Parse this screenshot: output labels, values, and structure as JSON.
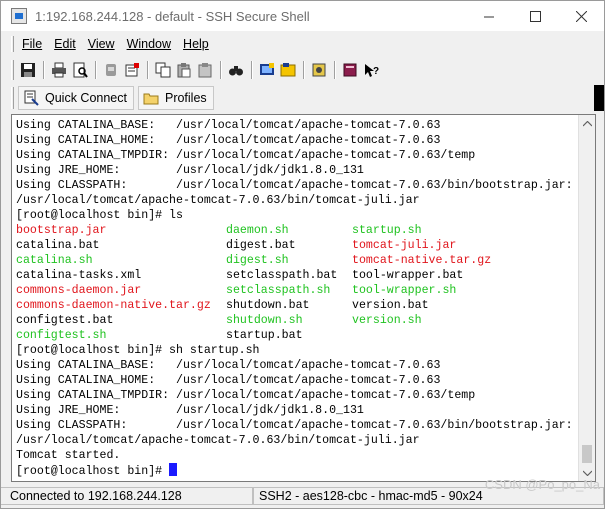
{
  "window": {
    "title": "1:192.168.244.128 - default - SSH Secure Shell",
    "controls": {
      "minimize": "minimize",
      "maximize": "maximize",
      "close": "close"
    }
  },
  "menu": {
    "items": [
      {
        "label": "File"
      },
      {
        "label": "Edit"
      },
      {
        "label": "View"
      },
      {
        "label": "Window"
      },
      {
        "label": "Help"
      }
    ]
  },
  "toolbar": {
    "icons": [
      "save-icon",
      "print-icon",
      "print-preview-icon",
      "disconnect-icon",
      "edit-profile-icon",
      "copy-icon",
      "paste-icon",
      "paste-selection-icon",
      "find-icon",
      "new-terminal-icon",
      "file-transfer-icon",
      "settings-icon",
      "help-book-icon",
      "whats-this-icon"
    ]
  },
  "quickbar": {
    "quick_connect": "Quick Connect",
    "profiles": "Profiles"
  },
  "terminal": {
    "lines_top": [
      "Using CATALINA_BASE:   /usr/local/tomcat/apache-tomcat-7.0.63",
      "Using CATALINA_HOME:   /usr/local/tomcat/apache-tomcat-7.0.63",
      "Using CATALINA_TMPDIR: /usr/local/tomcat/apache-tomcat-7.0.63/temp",
      "Using JRE_HOME:        /usr/local/jdk/jdk1.8.0_131",
      "Using CLASSPATH:       /usr/local/tomcat/apache-tomcat-7.0.63/bin/bootstrap.jar:",
      "/usr/local/tomcat/apache-tomcat-7.0.63/bin/tomcat-juli.jar",
      "[root@localhost bin]# ls"
    ],
    "ls_rows": [
      [
        {
          "t": "bootstrap.jar",
          "c": "red"
        },
        {
          "t": "daemon.sh",
          "c": "green"
        },
        {
          "t": "startup.sh",
          "c": "green"
        }
      ],
      [
        {
          "t": "catalina.bat",
          "c": ""
        },
        {
          "t": "digest.bat",
          "c": ""
        },
        {
          "t": "tomcat-juli.jar",
          "c": "red"
        }
      ],
      [
        {
          "t": "catalina.sh",
          "c": "green"
        },
        {
          "t": "digest.sh",
          "c": "green"
        },
        {
          "t": "tomcat-native.tar.gz",
          "c": "red"
        }
      ],
      [
        {
          "t": "catalina-tasks.xml",
          "c": ""
        },
        {
          "t": "setclasspath.bat",
          "c": ""
        },
        {
          "t": "tool-wrapper.bat",
          "c": ""
        }
      ],
      [
        {
          "t": "commons-daemon.jar",
          "c": "red"
        },
        {
          "t": "setclasspath.sh",
          "c": "green"
        },
        {
          "t": "tool-wrapper.sh",
          "c": "green"
        }
      ],
      [
        {
          "t": "commons-daemon-native.tar.gz",
          "c": "red"
        },
        {
          "t": "shutdown.bat",
          "c": ""
        },
        {
          "t": "version.bat",
          "c": ""
        }
      ],
      [
        {
          "t": "configtest.bat",
          "c": ""
        },
        {
          "t": "shutdown.sh",
          "c": "green"
        },
        {
          "t": "version.sh",
          "c": "green"
        }
      ],
      [
        {
          "t": "configtest.sh",
          "c": "green"
        },
        {
          "t": "startup.bat",
          "c": ""
        },
        {
          "t": "",
          "c": ""
        }
      ]
    ],
    "lines_bottom": [
      "[root@localhost bin]# sh startup.sh",
      "Using CATALINA_BASE:   /usr/local/tomcat/apache-tomcat-7.0.63",
      "Using CATALINA_HOME:   /usr/local/tomcat/apache-tomcat-7.0.63",
      "Using CATALINA_TMPDIR: /usr/local/tomcat/apache-tomcat-7.0.63/temp",
      "Using JRE_HOME:        /usr/local/jdk/jdk1.8.0_131",
      "Using CLASSPATH:       /usr/local/tomcat/apache-tomcat-7.0.63/bin/bootstrap.jar:",
      "/usr/local/tomcat/apache-tomcat-7.0.63/bin/tomcat-juli.jar",
      "Tomcat started."
    ],
    "prompt": "[root@localhost bin]# ",
    "colors": {
      "red": "#e0141b",
      "green": "#1fc21f",
      "cursor": "#1a1aff"
    }
  },
  "status": {
    "connection": "Connected to 192.168.244.128",
    "details": "SSH2 - aes128-cbc - hmac-md5 - 90x24"
  },
  "watermark": "CSDN @Po_po_Na"
}
